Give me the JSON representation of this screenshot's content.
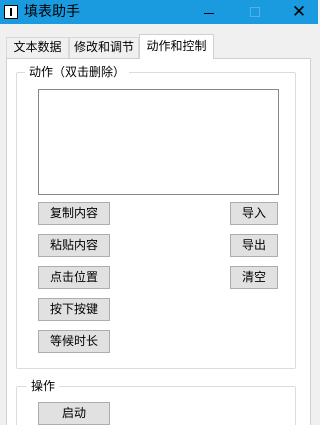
{
  "window": {
    "title": "填表助手",
    "minimize_icon": "minimize-icon",
    "maximize_icon": "maximize-icon",
    "close_glyph": "✕",
    "titlebar_color": "#1a9be0"
  },
  "tabs": [
    {
      "label": "文本数据",
      "selected": false
    },
    {
      "label": "修改和调节",
      "selected": false
    },
    {
      "label": "动作和控制",
      "selected": true
    }
  ],
  "actions_group": {
    "legend": "动作（双击删除）",
    "list_items": [],
    "left_buttons": [
      "复制内容",
      "粘贴内容",
      "点击位置",
      "按下按键",
      "等候时长"
    ],
    "right_buttons": [
      "导入",
      "导出",
      "清空"
    ]
  },
  "operations_group": {
    "legend": "操作",
    "start_button": "启动"
  }
}
